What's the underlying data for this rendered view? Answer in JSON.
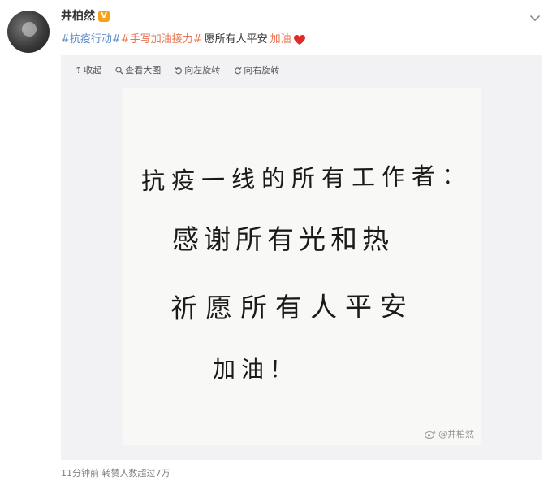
{
  "user": {
    "name": "井柏然",
    "badge": "V"
  },
  "post": {
    "topic1": "#抗疫行动#",
    "topic2": "#手写加油接力#",
    "text": "愿所有人平安",
    "cheer": "加油"
  },
  "toolbar": {
    "collapse_label": "收起",
    "view_large_label": "查看大图",
    "rotate_left_label": "向左旋转",
    "rotate_right_label": "向右旋转"
  },
  "photo": {
    "line1": "抗疫一线的所有工作者：",
    "line2": "感谢所有光和热",
    "line3": "祈愿所有人平安",
    "line4": "加油！",
    "watermark": "@井柏然"
  },
  "footer": {
    "meta": "11分钟前 转赞人数超过7万"
  },
  "colors": {
    "topic_orange": "#eb7350",
    "topic_blue": "#5a8ac8",
    "heart_red": "#e02a2a",
    "vip_badge": "#f7a21b"
  }
}
